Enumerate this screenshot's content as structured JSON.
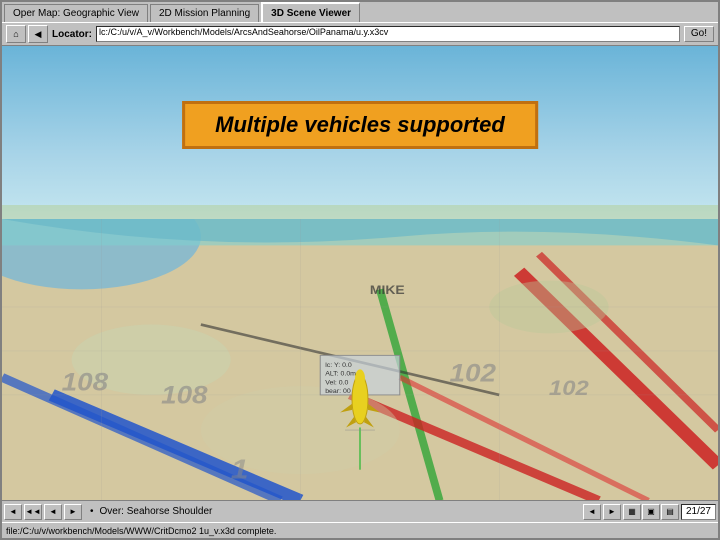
{
  "tabs": [
    {
      "label": "Oper Map: Geographic View",
      "active": false
    },
    {
      "label": "2D Mission Planning",
      "active": false
    },
    {
      "label": "3D Scene Viewer",
      "active": true
    }
  ],
  "toolbar": {
    "locator_label": "Locator:",
    "locator_value": "lc:/C:/u/v/A_v/Workbench/Models/ArcsAndSeahorse/OilPanama/u.y.x3cv",
    "go_button": "Go!"
  },
  "banner": {
    "text": "Multiple vehicles supported"
  },
  "status_bar": {
    "location_text": "Over: Seahorse Shoulder",
    "page": "21/27"
  },
  "file_path": {
    "text": "file:/C:/u/v/workbench/Models/WWW/CritDcmo2  1u_v.x3d complete."
  },
  "map_numbers": [
    "108",
    "108",
    "102",
    "102",
    "1"
  ]
}
